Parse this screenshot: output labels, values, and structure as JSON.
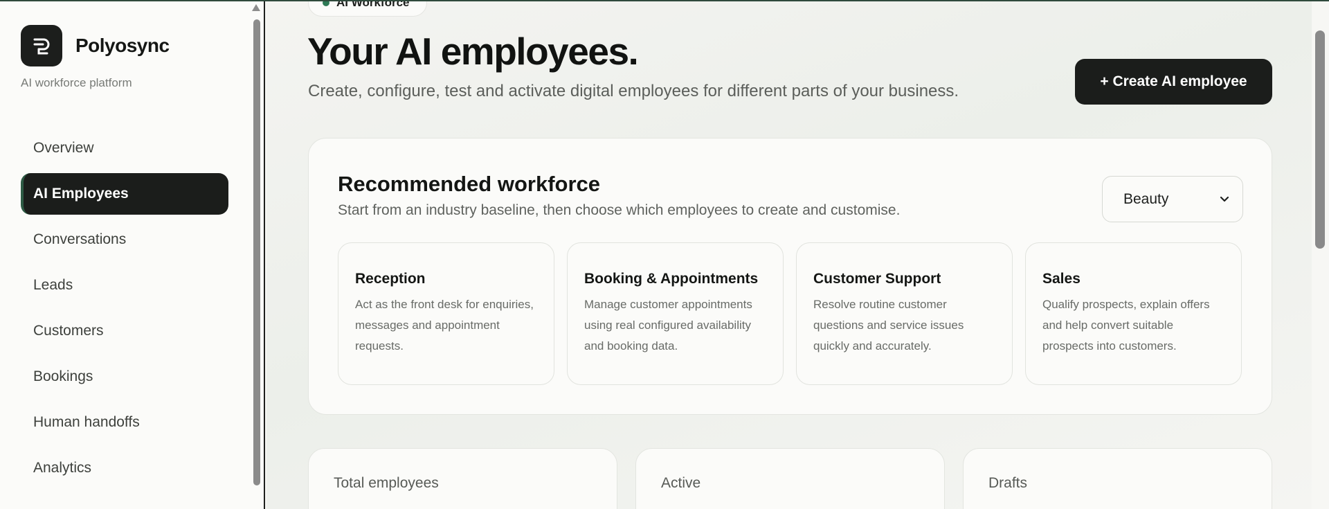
{
  "brand": {
    "name": "Polyosync",
    "tagline": "AI workforce platform",
    "logo_icon": "polyosync-logo-icon"
  },
  "nav": {
    "items": [
      {
        "label": "Overview",
        "active": false
      },
      {
        "label": "AI Employees",
        "active": true
      },
      {
        "label": "Conversations",
        "active": false
      },
      {
        "label": "Leads",
        "active": false
      },
      {
        "label": "Customers",
        "active": false
      },
      {
        "label": "Bookings",
        "active": false
      },
      {
        "label": "Human handoffs",
        "active": false
      },
      {
        "label": "Analytics",
        "active": false
      }
    ]
  },
  "header": {
    "badge": "AI Workforce",
    "title": "Your AI employees.",
    "subtitle": "Create, configure, test and activate digital employees for different parts of your business.",
    "create_button": "+ Create AI employee"
  },
  "recommended": {
    "title": "Recommended workforce",
    "subtitle": "Start from an industry baseline, then choose which employees to create and customise.",
    "industry_selected": "Beauty",
    "roles": [
      {
        "name": "Reception",
        "description": "Act as the front desk for enquiries, messages and appointment requests."
      },
      {
        "name": "Booking & Appointments",
        "description": "Manage customer appointments using real configured availability and booking data."
      },
      {
        "name": "Customer Support",
        "description": "Resolve routine customer questions and service issues quickly and accurately."
      },
      {
        "name": "Sales",
        "description": "Qualify prospects, explain offers and help convert suitable prospects into customers."
      }
    ]
  },
  "stats": [
    {
      "label": "Total employees"
    },
    {
      "label": "Active"
    },
    {
      "label": "Drafts"
    }
  ],
  "colors": {
    "accent": "#2e7a55",
    "dark": "#1b1d1b"
  }
}
